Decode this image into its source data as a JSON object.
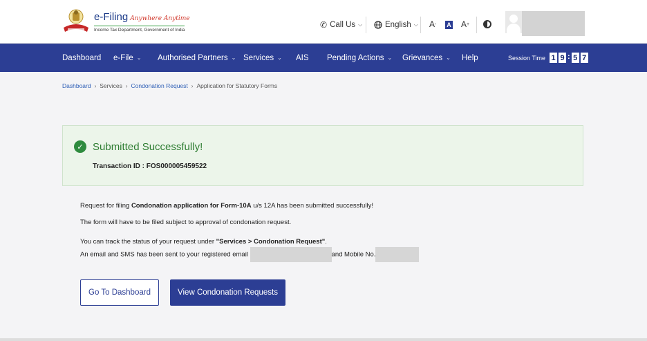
{
  "header": {
    "logo_title": "e-Filing",
    "logo_tagline": "Anywhere Anytime",
    "logo_subtitle": "Income Tax Department, Government of India",
    "call_us": "Call Us",
    "language": "English",
    "font_decrease": "A",
    "font_default": "A",
    "font_increase": "A",
    "font_decrease_mark": "-",
    "font_increase_mark": "+"
  },
  "nav": {
    "items": [
      {
        "label": "Dashboard",
        "dropdown": false
      },
      {
        "label": "e-File",
        "dropdown": true
      },
      {
        "label": "Authorised Partners",
        "dropdown": true
      },
      {
        "label": "Services",
        "dropdown": true
      },
      {
        "label": "AIS",
        "dropdown": false
      },
      {
        "label": "Pending Actions",
        "dropdown": true
      },
      {
        "label": "Grievances",
        "dropdown": true
      },
      {
        "label": "Help",
        "dropdown": false
      }
    ],
    "session_label": "Session Time",
    "session_digits": [
      "1",
      "9",
      "5",
      "7"
    ]
  },
  "breadcrumb": {
    "items": [
      "Dashboard",
      "Services",
      "Condonation Request",
      "Application for Statutory Forms"
    ]
  },
  "success": {
    "title": "Submitted Successfully!",
    "transaction_label": "Transaction ID : ",
    "transaction_id": "FOS000005459522"
  },
  "message": {
    "line1_pre": "Request for filing ",
    "line1_bold": "Condonation application for Form-10A",
    "line1_post": " u/s 12A has been submitted successfully!",
    "line2": "The form will have to be filed subject to approval of condonation request.",
    "line3_pre": "You can track the status of your request under ",
    "line3_bold": "\"Services > Condonation Request\"",
    "line3_post": ".",
    "line4_pre": "An email and SMS has been sent to your registered email ",
    "line4_mid": "and Mobile No."
  },
  "buttons": {
    "dashboard": "Go To Dashboard",
    "view_requests": "View Condonation Requests"
  },
  "colors": {
    "brand_blue": "#2c3e94",
    "success_green": "#2e7d32",
    "success_bg": "#ecf5ea"
  }
}
